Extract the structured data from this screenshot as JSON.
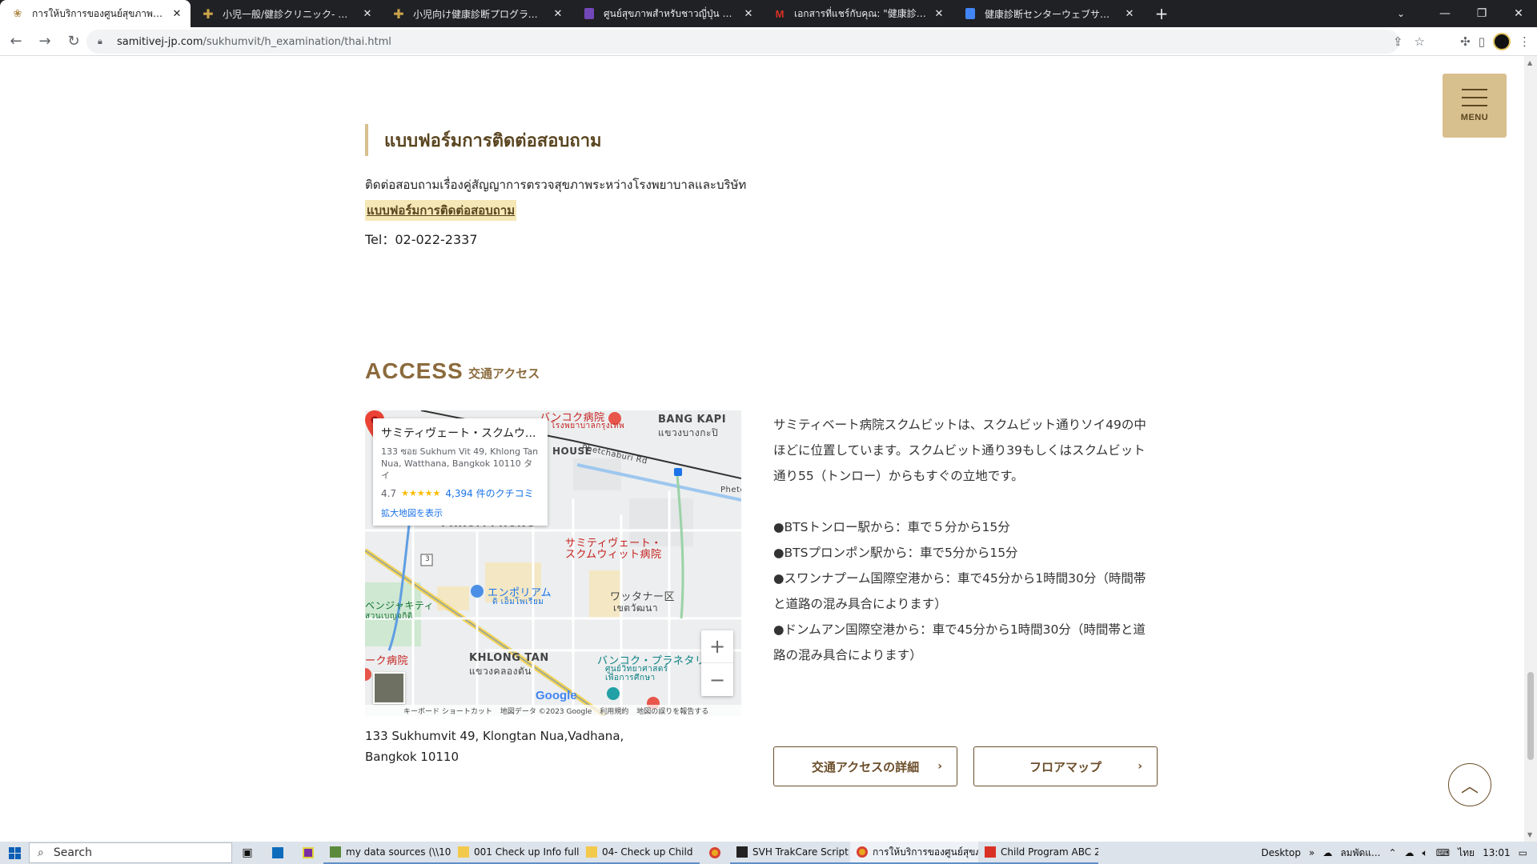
{
  "browser": {
    "tabs": [
      {
        "title": "การให้บริการของศูนย์สุขภาพสำหรับชาวญี่ปุ่น",
        "favicon_color": "#b08a4a",
        "active": true
      },
      {
        "title": "小児一般/健診クリニック- タイのバンコク",
        "favicon_color": "#c9a24a",
        "active": false
      },
      {
        "title": "小児向け健康診断プログラム- タイのバンコク",
        "favicon_color": "#c9a24a",
        "active": false
      },
      {
        "title": "ศูนย์สุขภาพสำหรับชาวญี่ปุ่น สมิติเวช",
        "favicon_color": "#7248b9",
        "active": false
      },
      {
        "title": "เอกสารที่แชร์กับคุณ: \"健康診断セン",
        "favicon_color": "#d93025",
        "active": false
      },
      {
        "title": "健康診断センターウェブサイト - Google",
        "favicon_color": "#4285f4",
        "active": false
      }
    ],
    "url_host": "samitivej-jp.com",
    "url_path": "/sukhumvit/h_examination/thai.html"
  },
  "page": {
    "menu_label": "MENU",
    "contact": {
      "heading": "แบบฟอร์มการติดต่อสอบถาม",
      "description": "ติดต่อสอบถามเรื่องคู่สัญญาการตรวจสุขภาพระหว่างโรงพยาบาลและบริษัท",
      "link_text": "แบบฟอร์มการติดต่อสอบถาม",
      "tel": "Tel：02-022-2337"
    },
    "access": {
      "title": "ACCESS",
      "subtitle": "交通アクセス",
      "intro": "サミティベート病院スクムビットは、スクムビット通りソイ49の中ほどに位置しています。スクムビット通り39もしくはスクムビット通り55（トンロー）からもすぐの立地です。",
      "routes": [
        "●BTSトンロー駅から：車で５分から15分",
        "●BTSプロンポン駅から：車で5分から15分",
        "●スワンナプーム国際空港から：車で45分から1時間30分（時間帯と道路の混み具合によります）",
        "●ドンムアン国際空港から：車で45分から1時間30分（時間帯と道路の混み具合によります）"
      ],
      "address_line1": "133 Sukhumvit 49, Klongtan Nua,Vadhana,",
      "address_line2": "Bangkok 10110",
      "button_detail": "交通アクセスの詳細",
      "button_floormap": "フロアマップ"
    },
    "map": {
      "card_title": "サミティヴェート・スクムウ...",
      "card_address": "133 ซอย Sukhum Vit 49, Khlong Tan Nua, Watthana, Bangkok 10110 タイ",
      "rating": "4.7",
      "stars": "★★★★★",
      "reviews": "4,394 件のクチコミ",
      "view_larger": "拡大地図を表示",
      "labels": {
        "bangkok_hospital": "バンコク病院",
        "bangkok_hospital_th": "โรงพยาบาลกรุงเทพ",
        "bang_kapi": "BANG KAPI",
        "bang_kapi_th": "แขวงบางกะปิ",
        "phetchaburi": "Phetchaburi Rd",
        "phetch": "Phetch",
        "phrom_phong": "PHROM PHONG",
        "hospital_name": "サミティヴェート・\nスクムウィット病院",
        "emporium": "エンポリアム",
        "emporium_th": "ดิ เอ็มโพเรียม",
        "watthana": "ワッタナー区",
        "watthana_th": "เขตวัฒนา",
        "benjakitti": "ベンジャキティ",
        "benjakitti_th": "สวนเบญจกิติ",
        "khlong_tan": "KHLONG TAN",
        "khlong_tan_th": "แขวงคลองตัน",
        "planetarium": "バンコク・プラネタリ",
        "planetarium_th": "ศูนย์วิทยาศาสตร์\nเพื่อการศึกษา",
        "ku_hospital": "ーク病院",
        "house": "HOUSE",
        "route_3": "3"
      },
      "google": "Google",
      "footer": [
        "キーボード ショートカット",
        "地図データ ©2023 Google",
        "利用規約",
        "地図の誤りを報告する"
      ]
    }
  },
  "taskbar": {
    "search": "Search",
    "apps": [
      "my data sources (\\\\10...",
      "001 Check up Info full...",
      "04- Check up Child",
      "SVH TrakCare Script",
      "การให้บริการของศูนย์สุขภ...",
      "Child Program ABC 2..."
    ],
    "desktop": "Desktop",
    "weather": "ลมพัดแ...",
    "lang": "ไทย",
    "time": "13:01"
  }
}
